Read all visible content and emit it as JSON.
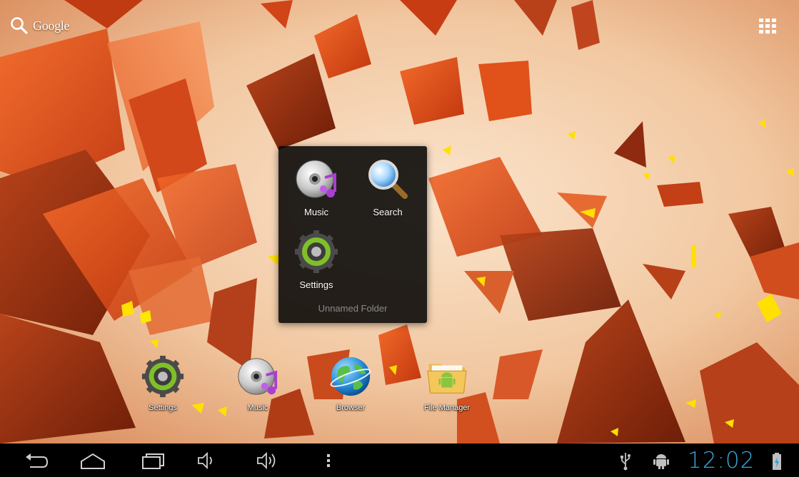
{
  "home": {
    "google_label": "Google",
    "search_icon": "search-icon",
    "apps_icon": "apps-grid-icon"
  },
  "folder": {
    "name": "Unnamed Folder",
    "apps": [
      {
        "label": "Music",
        "icon": "music-icon"
      },
      {
        "label": "Search",
        "icon": "search-icon"
      },
      {
        "label": "Settings",
        "icon": "settings-icon"
      }
    ]
  },
  "dock": [
    {
      "label": "Settings",
      "icon": "settings-icon"
    },
    {
      "label": "Music",
      "icon": "music-icon"
    },
    {
      "label": "Browser",
      "icon": "browser-icon"
    },
    {
      "label": "File Manager",
      "icon": "file-manager-icon"
    }
  ],
  "system_bar": {
    "clock": "12:02",
    "buttons": [
      "back-icon",
      "home-icon",
      "recent-apps-icon",
      "volume-down-icon",
      "volume-up-icon",
      "menu-icon"
    ],
    "status_icons": [
      "usb-icon",
      "debug-icon",
      "battery-icon"
    ],
    "accent": "#3aa7d8"
  },
  "colors": {
    "wallpaper_base": "#f2c8a2",
    "shard": "#e0521a",
    "shard_dark": "#8e2a10",
    "shard_yellow": "#ffe000"
  }
}
